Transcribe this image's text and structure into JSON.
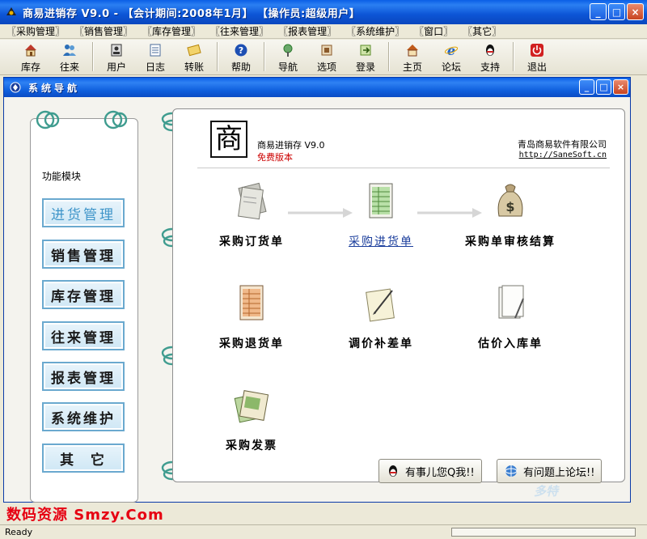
{
  "window": {
    "title": "商易进销存 V9.0 - 【会计期间:2008年1月】 【操作员:超级用户】",
    "minimize": "_",
    "maximize": "□",
    "close": "×"
  },
  "menu": [
    "〖采购管理〗",
    "〖销售管理〗",
    "〖库存管理〗",
    "〖往来管理〗",
    "〖报表管理〗",
    "〖系统维护〗",
    "〖窗口〗",
    "〖其它〗"
  ],
  "toolbar": [
    {
      "label": "库存",
      "icon": "house-icon",
      "color": "#c0392b"
    },
    {
      "label": "往来",
      "icon": "people-icon",
      "color": "#2c6fb8"
    },
    {
      "label": "用户",
      "icon": "user-icon",
      "color": "#3a3a3a"
    },
    {
      "label": "日志",
      "icon": "log-icon",
      "color": "#4a6b9a"
    },
    {
      "label": "转账",
      "icon": "transfer-icon",
      "color": "#b8860b"
    },
    {
      "label": "帮助",
      "icon": "help-icon",
      "color": "#1d4fb3"
    },
    {
      "label": "导航",
      "icon": "navigate-icon",
      "color": "#2c7a2c"
    },
    {
      "label": "选项",
      "icon": "options-icon",
      "color": "#8b5a2b"
    },
    {
      "label": "登录",
      "icon": "login-icon",
      "color": "#5b8c2a"
    },
    {
      "label": "主页",
      "icon": "home-icon",
      "color": "#c05a1a"
    },
    {
      "label": "论坛",
      "icon": "ie-icon",
      "color": "#1e63c9"
    },
    {
      "label": "支持",
      "icon": "qq-icon",
      "color": "#111111"
    },
    {
      "label": "退出",
      "icon": "exit-icon",
      "color": "#d12020"
    }
  ],
  "nav_window": {
    "title": "系统导航",
    "panel_title": "功能模块",
    "modules": [
      "进货管理",
      "销售管理",
      "库存管理",
      "往来管理",
      "报表管理",
      "系统维护",
      "其  它"
    ],
    "active_module": 0
  },
  "content": {
    "logo_char": "商",
    "product": "商易进销存 V9.0",
    "edition": "免费版本",
    "company": "青岛商易软件有限公司",
    "url": "http://SaneSoft.cn",
    "functions": [
      {
        "label": "采购订货单",
        "icon": "order-icon",
        "link": false
      },
      {
        "label": "采购进货单",
        "icon": "receipt-icon",
        "link": true
      },
      {
        "label": "采购单审核结算",
        "icon": "moneybag-icon",
        "link": false
      },
      {
        "label": "采购退货单",
        "icon": "return-icon",
        "link": false
      },
      {
        "label": "调价补差单",
        "icon": "adjust-icon",
        "link": false
      },
      {
        "label": "估价入库单",
        "icon": "estimate-icon",
        "link": false
      },
      {
        "label": "采购发票",
        "icon": "invoice-icon",
        "link": false
      }
    ],
    "help_qq": "有事儿您Q我!!",
    "help_forum": "有问题上论坛!!"
  },
  "watermark": "数码资源 Smzy.Com",
  "watermark2": "多特",
  "status": "Ready",
  "colors": {
    "accent": "#0a5ee6",
    "module_border": "#6aa9cf",
    "watermark": "#e60012"
  }
}
